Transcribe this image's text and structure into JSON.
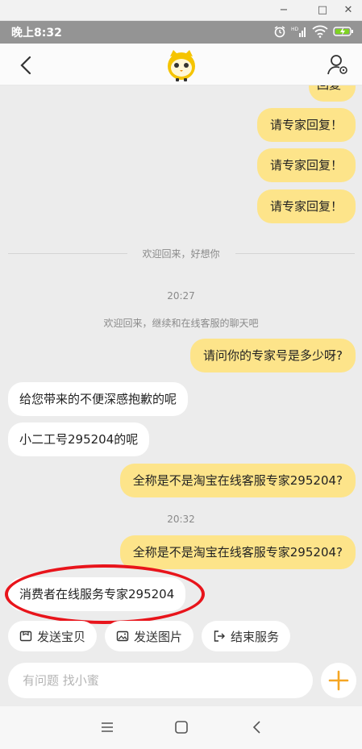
{
  "window": {
    "minimize": "−",
    "maximize": "□",
    "close": "✕"
  },
  "status_bar": {
    "time": "晚上8:32",
    "icons": [
      "alarm-icon",
      "hd-signal-icon",
      "wifi-icon",
      "battery-charging-icon"
    ]
  },
  "header": {
    "back_icon": "chevron-left-icon",
    "logo_icon": "xiaomi-mascot-icon",
    "profile_icon": "user-settings-icon"
  },
  "messages": [
    {
      "from": "me",
      "text": "回复"
    },
    {
      "from": "me",
      "text": "请专家回复！"
    },
    {
      "from": "me",
      "text": "请专家回复！"
    },
    {
      "from": "me",
      "text": "请专家回复！"
    }
  ],
  "divider_text": "欢迎回来，好想你",
  "time_1": "20:27",
  "welcome_text": "欢迎回来，继续和在线客服的聊天吧",
  "messages_2": [
    {
      "from": "me",
      "text": "请问你的专家号是多少呀?"
    },
    {
      "from": "them",
      "text": "给您带来的不便深感抱歉的呢"
    },
    {
      "from": "them",
      "text": "小二工号295204的呢"
    },
    {
      "from": "me",
      "text": "全称是不是淘宝在线客服专家295204?"
    }
  ],
  "time_2": "20:32",
  "messages_3": [
    {
      "from": "me",
      "text": "全称是不是淘宝在线客服专家295204?"
    },
    {
      "from": "them",
      "text": "消费者在线服务专家295204"
    }
  ],
  "quick_actions": [
    {
      "label": "发送宝贝",
      "icon": "product-box-icon"
    },
    {
      "label": "发送图片",
      "icon": "image-icon"
    },
    {
      "label": "结束服务",
      "icon": "exit-icon"
    }
  ],
  "input": {
    "placeholder": "有问题 找小蜜",
    "plus_icon": "plus-icon"
  },
  "nav": {
    "menu_icon": "menu-icon",
    "home_icon": "home-square-icon",
    "back_icon": "nav-back-icon"
  },
  "colors": {
    "my_bubble": "#fde48a",
    "their_bubble": "#ffffff",
    "accent": "#f5a623",
    "annotation": "#e8141b"
  }
}
